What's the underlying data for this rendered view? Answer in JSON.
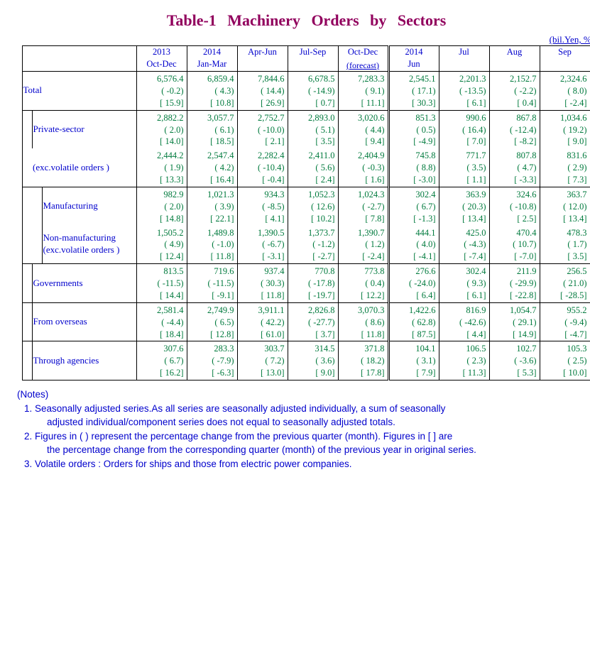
{
  "title": "Table-1   Machinery   Orders   by   Sectors",
  "unit": "(bil.Yen, %)",
  "columns": [
    {
      "year": "2013",
      "period": "Oct-Dec",
      "sub": ""
    },
    {
      "year": "2014",
      "period": "Jan-Mar",
      "sub": ""
    },
    {
      "year": "",
      "period": "Apr-Jun",
      "sub": ""
    },
    {
      "year": "",
      "period": "Jul-Sep",
      "sub": ""
    },
    {
      "year": "",
      "period": "Oct-Dec",
      "sub": "(forecast)"
    },
    {
      "year": "2014",
      "period": "Jun",
      "sub": ""
    },
    {
      "year": "",
      "period": "Jul",
      "sub": ""
    },
    {
      "year": "",
      "period": "Aug",
      "sub": ""
    },
    {
      "year": "",
      "period": "Sep",
      "sub": ""
    }
  ],
  "rows": [
    {
      "key": "total",
      "label": "Total",
      "indent": 0,
      "topline": false,
      "cells": [
        {
          "v": "6,576.4",
          "p1": "( -0.2)",
          "p2": "[ 15.9]"
        },
        {
          "v": "6,859.4",
          "p1": "( 4.3)",
          "p2": "[ 10.8]"
        },
        {
          "v": "7,844.6",
          "p1": "( 14.4)",
          "p2": "[ 26.9]"
        },
        {
          "v": "6,678.5",
          "p1": "( -14.9)",
          "p2": "[ 0.7]"
        },
        {
          "v": "7,283.3",
          "p1": "( 9.1)",
          "p2": "[ 11.1]"
        },
        {
          "v": "2,545.1",
          "p1": "( 17.1)",
          "p2": "[ 30.3]"
        },
        {
          "v": "2,201.3",
          "p1": "( -13.5)",
          "p2": "[ 6.1]"
        },
        {
          "v": "2,152.7",
          "p1": "( -2.2)",
          "p2": "[ 0.4]"
        },
        {
          "v": "2,324.6",
          "p1": "( 8.0)",
          "p2": "[ -2.4]"
        }
      ]
    },
    {
      "key": "private",
      "label": "Private-sector",
      "indent": 1,
      "topline": true,
      "cells": [
        {
          "v": "2,882.2",
          "p1": "( 2.0)",
          "p2": "[ 14.0]"
        },
        {
          "v": "3,057.7",
          "p1": "( 6.1)",
          "p2": "[ 18.5]"
        },
        {
          "v": "2,752.7",
          "p1": "( -10.0)",
          "p2": "[ 2.1]"
        },
        {
          "v": "2,893.0",
          "p1": "( 5.1)",
          "p2": "[ 3.5]"
        },
        {
          "v": "3,020.6",
          "p1": "( 4.4)",
          "p2": "[ 9.4]"
        },
        {
          "v": "851.3",
          "p1": "( 0.5)",
          "p2": "[ -4.9]"
        },
        {
          "v": "990.6",
          "p1": "( 16.4)",
          "p2": "[ 7.0]"
        },
        {
          "v": "867.8",
          "p1": "( -12.4)",
          "p2": "[ -8.2]"
        },
        {
          "v": "1,034.6",
          "p1": "( 19.2)",
          "p2": "[ 9.0]"
        }
      ]
    },
    {
      "key": "exvol",
      "label": "(exc.volatile orders )",
      "indent": 1,
      "topline": false,
      "cells": [
        {
          "v": "2,444.2",
          "p1": "( 1.9)",
          "p2": "[ 13.3]"
        },
        {
          "v": "2,547.4",
          "p1": "( 4.2)",
          "p2": "[ 16.4]"
        },
        {
          "v": "2,282.4",
          "p1": "( -10.4)",
          "p2": "[ -0.4]"
        },
        {
          "v": "2,411.0",
          "p1": "( 5.6)",
          "p2": "[ 2.4]"
        },
        {
          "v": "2,404.9",
          "p1": "( -0.3)",
          "p2": "[ 1.6]"
        },
        {
          "v": "745.8",
          "p1": "( 8.8)",
          "p2": "[ -3.0]"
        },
        {
          "v": "771.7",
          "p1": "( 3.5)",
          "p2": "[ 1.1]"
        },
        {
          "v": "807.8",
          "p1": "( 4.7)",
          "p2": "[ -3.3]"
        },
        {
          "v": "831.6",
          "p1": "( 2.9)",
          "p2": "[ 7.3]"
        }
      ]
    },
    {
      "key": "mfg",
      "label": "Manufacturing",
      "indent": 2,
      "topline": true,
      "cells": [
        {
          "v": "982.9",
          "p1": "( 2.0)",
          "p2": "[ 14.8]"
        },
        {
          "v": "1,021.3",
          "p1": "( 3.9)",
          "p2": "[ 22.1]"
        },
        {
          "v": "934.3",
          "p1": "( -8.5)",
          "p2": "[ 4.1]"
        },
        {
          "v": "1,052.3",
          "p1": "( 12.6)",
          "p2": "[ 10.2]"
        },
        {
          "v": "1,024.3",
          "p1": "( -2.7)",
          "p2": "[ 7.8]"
        },
        {
          "v": "302.4",
          "p1": "( 6.7)",
          "p2": "[ -1.3]"
        },
        {
          "v": "363.9",
          "p1": "( 20.3)",
          "p2": "[ 13.4]"
        },
        {
          "v": "324.6",
          "p1": "( -10.8)",
          "p2": "[ 2.5]"
        },
        {
          "v": "363.7",
          "p1": "( 12.0)",
          "p2": "[ 13.4]"
        }
      ]
    },
    {
      "key": "nonmfg",
      "label": "Non-manufacturing",
      "label2": "(exc.volatile orders )",
      "indent": 2,
      "topline": false,
      "cells": [
        {
          "v": "1,505.2",
          "p1": "( 4.9)",
          "p2": "[ 12.4]"
        },
        {
          "v": "1,489.8",
          "p1": "( -1.0)",
          "p2": "[ 11.8]"
        },
        {
          "v": "1,390.5",
          "p1": "( -6.7)",
          "p2": "[ -3.1]"
        },
        {
          "v": "1,373.7",
          "p1": "( -1.2)",
          "p2": "[ -2.7]"
        },
        {
          "v": "1,390.7",
          "p1": "( 1.2)",
          "p2": "[ -2.4]"
        },
        {
          "v": "444.1",
          "p1": "( 4.0)",
          "p2": "[ -4.1]"
        },
        {
          "v": "425.0",
          "p1": "( -4.3)",
          "p2": "[ -7.4]"
        },
        {
          "v": "470.4",
          "p1": "( 10.7)",
          "p2": "[ -7.0]"
        },
        {
          "v": "478.3",
          "p1": "( 1.7)",
          "p2": "[ 3.5]"
        }
      ]
    },
    {
      "key": "gov",
      "label": "Governments",
      "indent": 1,
      "topline": true,
      "cells": [
        {
          "v": "813.5",
          "p1": "( -11.5)",
          "p2": "[ 14.4]"
        },
        {
          "v": "719.6",
          "p1": "( -11.5)",
          "p2": "[ -9.1]"
        },
        {
          "v": "937.4",
          "p1": "( 30.3)",
          "p2": "[ 11.8]"
        },
        {
          "v": "770.8",
          "p1": "( -17.8)",
          "p2": "[ -19.7]"
        },
        {
          "v": "773.8",
          "p1": "( 0.4)",
          "p2": "[ 12.2]"
        },
        {
          "v": "276.6",
          "p1": "( -24.0)",
          "p2": "[ 6.4]"
        },
        {
          "v": "302.4",
          "p1": "( 9.3)",
          "p2": "[ 6.1]"
        },
        {
          "v": "211.9",
          "p1": "( -29.9)",
          "p2": "[ -22.8]"
        },
        {
          "v": "256.5",
          "p1": "( 21.0)",
          "p2": "[ -28.5]"
        }
      ]
    },
    {
      "key": "overseas",
      "label": "From overseas",
      "indent": 1,
      "topline": true,
      "cells": [
        {
          "v": "2,581.4",
          "p1": "( -4.4)",
          "p2": "[ 18.4]"
        },
        {
          "v": "2,749.9",
          "p1": "( 6.5)",
          "p2": "[ 12.8]"
        },
        {
          "v": "3,911.1",
          "p1": "( 42.2)",
          "p2": "[ 61.0]"
        },
        {
          "v": "2,826.8",
          "p1": "( -27.7)",
          "p2": "[ 3.7]"
        },
        {
          "v": "3,070.3",
          "p1": "( 8.6)",
          "p2": "[ 11.8]"
        },
        {
          "v": "1,422.6",
          "p1": "( 62.8)",
          "p2": "[ 87.5]"
        },
        {
          "v": "816.9",
          "p1": "( -42.6)",
          "p2": "[ 4.4]"
        },
        {
          "v": "1,054.7",
          "p1": "( 29.1)",
          "p2": "[ 14.9]"
        },
        {
          "v": "955.2",
          "p1": "( -9.4)",
          "p2": "[ -4.7]"
        }
      ]
    },
    {
      "key": "agencies",
      "label": "Through agencies",
      "indent": 1,
      "topline": true,
      "cells": [
        {
          "v": "307.6",
          "p1": "( 6.7)",
          "p2": "[ 16.2]"
        },
        {
          "v": "283.3",
          "p1": "( -7.9)",
          "p2": "[ -6.3]"
        },
        {
          "v": "303.7",
          "p1": "( 7.2)",
          "p2": "[ 13.0]"
        },
        {
          "v": "314.5",
          "p1": "( 3.6)",
          "p2": "[ 9.0]"
        },
        {
          "v": "371.8",
          "p1": "( 18.2)",
          "p2": "[ 17.8]"
        },
        {
          "v": "104.1",
          "p1": "( 3.1)",
          "p2": "[ 7.9]"
        },
        {
          "v": "106.5",
          "p1": "( 2.3)",
          "p2": "[ 11.3]"
        },
        {
          "v": "102.7",
          "p1": "( -3.6)",
          "p2": "[ 5.3]"
        },
        {
          "v": "105.3",
          "p1": "( 2.5)",
          "p2": "[ 10.0]"
        }
      ]
    }
  ],
  "notes": {
    "heading": "(Notes)",
    "items": [
      [
        "1. Seasonally adjusted series.As all series are seasonally adjusted individually, a sum of seasonally",
        "adjusted individual/component series does not equal to seasonally adjusted totals."
      ],
      [
        "2. Figures in ( ) represent the percentage change from the previous quarter (month). Figures in [ ] are",
        "the percentage change from the corresponding quarter (month) of the previous year in original series."
      ],
      [
        "3. Volatile orders : Orders for ships and those from electric power companies."
      ]
    ]
  },
  "chart_data": {
    "type": "table",
    "title": "Table-1 Machinery Orders by Sectors",
    "unit": "bil.Yen, %",
    "periods": [
      "2013 Oct-Dec",
      "2014 Jan-Mar",
      "2014 Apr-Jun",
      "2014 Jul-Sep",
      "2014 Oct-Dec (forecast)",
      "2014 Jun",
      "2014 Jul",
      "2014 Aug",
      "2014 Sep"
    ],
    "series": [
      {
        "name": "Total",
        "values": [
          6576.4,
          6859.4,
          7844.6,
          6678.5,
          7283.3,
          2545.1,
          2201.3,
          2152.7,
          2324.6
        ],
        "qoq_pct": [
          -0.2,
          4.3,
          14.4,
          -14.9,
          9.1,
          17.1,
          -13.5,
          -2.2,
          8.0
        ],
        "yoy_pct": [
          15.9,
          10.8,
          26.9,
          0.7,
          11.1,
          30.3,
          6.1,
          0.4,
          -2.4
        ]
      },
      {
        "name": "Private-sector",
        "values": [
          2882.2,
          3057.7,
          2752.7,
          2893.0,
          3020.6,
          851.3,
          990.6,
          867.8,
          1034.6
        ],
        "qoq_pct": [
          2.0,
          6.1,
          -10.0,
          5.1,
          4.4,
          0.5,
          16.4,
          -12.4,
          19.2
        ],
        "yoy_pct": [
          14.0,
          18.5,
          2.1,
          3.5,
          9.4,
          -4.9,
          7.0,
          -8.2,
          9.0
        ]
      },
      {
        "name": "Private-sector (exc. volatile orders)",
        "values": [
          2444.2,
          2547.4,
          2282.4,
          2411.0,
          2404.9,
          745.8,
          771.7,
          807.8,
          831.6
        ],
        "qoq_pct": [
          1.9,
          4.2,
          -10.4,
          5.6,
          -0.3,
          8.8,
          3.5,
          4.7,
          2.9
        ],
        "yoy_pct": [
          13.3,
          16.4,
          -0.4,
          2.4,
          1.6,
          -3.0,
          1.1,
          -3.3,
          7.3
        ]
      },
      {
        "name": "Manufacturing",
        "values": [
          982.9,
          1021.3,
          934.3,
          1052.3,
          1024.3,
          302.4,
          363.9,
          324.6,
          363.7
        ],
        "qoq_pct": [
          2.0,
          3.9,
          -8.5,
          12.6,
          -2.7,
          6.7,
          20.3,
          -10.8,
          12.0
        ],
        "yoy_pct": [
          14.8,
          22.1,
          4.1,
          10.2,
          7.8,
          -1.3,
          13.4,
          2.5,
          13.4
        ]
      },
      {
        "name": "Non-manufacturing (exc. volatile orders)",
        "values": [
          1505.2,
          1489.8,
          1390.5,
          1373.7,
          1390.7,
          444.1,
          425.0,
          470.4,
          478.3
        ],
        "qoq_pct": [
          4.9,
          -1.0,
          -6.7,
          -1.2,
          1.2,
          4.0,
          -4.3,
          10.7,
          1.7
        ],
        "yoy_pct": [
          12.4,
          11.8,
          -3.1,
          -2.7,
          -2.4,
          -4.1,
          -7.4,
          -7.0,
          3.5
        ]
      },
      {
        "name": "Governments",
        "values": [
          813.5,
          719.6,
          937.4,
          770.8,
          773.8,
          276.6,
          302.4,
          211.9,
          256.5
        ],
        "qoq_pct": [
          -11.5,
          -11.5,
          30.3,
          -17.8,
          0.4,
          -24.0,
          9.3,
          -29.9,
          21.0
        ],
        "yoy_pct": [
          14.4,
          -9.1,
          11.8,
          -19.7,
          12.2,
          6.4,
          6.1,
          -22.8,
          -28.5
        ]
      },
      {
        "name": "From overseas",
        "values": [
          2581.4,
          2749.9,
          3911.1,
          2826.8,
          3070.3,
          1422.6,
          816.9,
          1054.7,
          955.2
        ],
        "qoq_pct": [
          -4.4,
          6.5,
          42.2,
          -27.7,
          8.6,
          62.8,
          -42.6,
          29.1,
          -9.4
        ],
        "yoy_pct": [
          18.4,
          12.8,
          61.0,
          3.7,
          11.8,
          87.5,
          4.4,
          14.9,
          -4.7
        ]
      },
      {
        "name": "Through agencies",
        "values": [
          307.6,
          283.3,
          303.7,
          314.5,
          371.8,
          104.1,
          106.5,
          102.7,
          105.3
        ],
        "qoq_pct": [
          6.7,
          -7.9,
          7.2,
          3.6,
          18.2,
          3.1,
          2.3,
          -3.6,
          2.5
        ],
        "yoy_pct": [
          16.2,
          -6.3,
          13.0,
          9.0,
          17.8,
          7.9,
          11.3,
          5.3,
          10.0
        ]
      }
    ]
  }
}
